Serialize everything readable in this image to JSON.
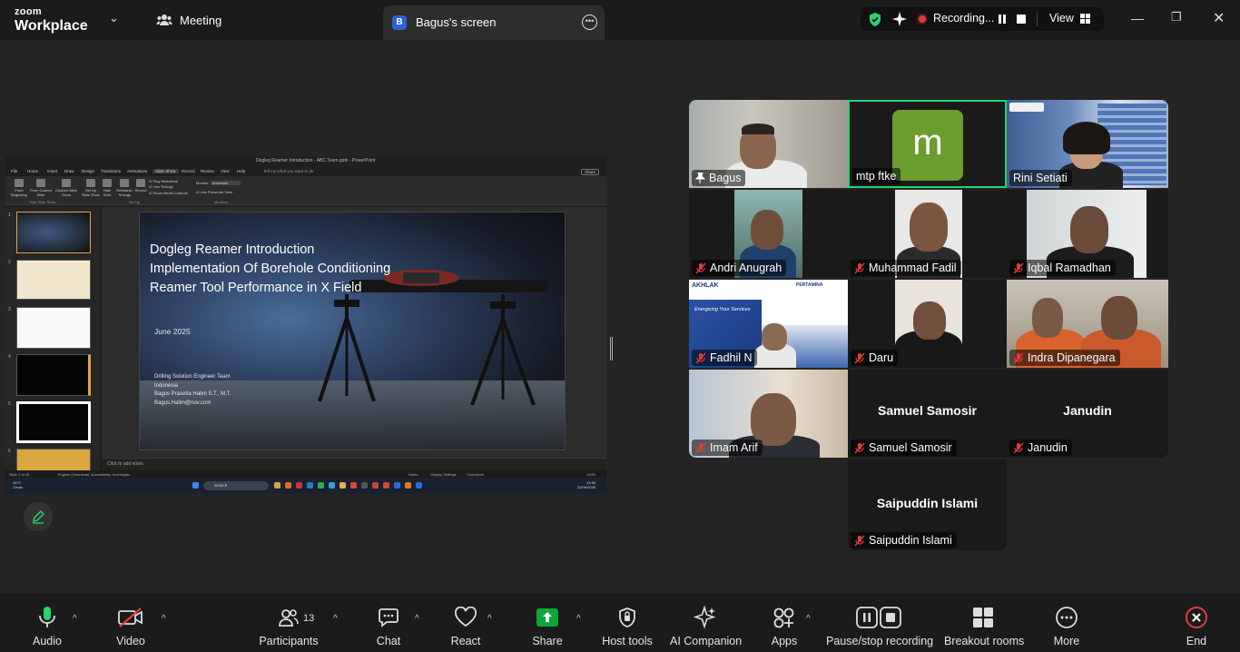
{
  "topbar": {
    "brand_line1": "zoom",
    "brand_line2": "Workplace",
    "meeting_tab": "Meeting",
    "screen_tab_badge": "B",
    "screen_tab_title": "Bagus's screen",
    "recording_text": "Recording...",
    "view_label": "View"
  },
  "share": {
    "window_title": "Dogleg Reamer Introduction - ABC Team.pptx - PowerPoint",
    "ribbon_tabs": [
      "File",
      "Home",
      "Insert",
      "Draw",
      "Design",
      "Transitions",
      "Animations",
      "Slide Show",
      "Record",
      "Review",
      "View",
      "Help"
    ],
    "active_tab": "Slide Show",
    "tell_me": "Tell me what you want to do",
    "share_btn": "Share",
    "ribbon_buttons": [
      "From Beginning",
      "From Current Slide",
      "Custom Slide Show",
      "Set Up Slide Show",
      "Hide Slide",
      "Rehearse Timings",
      "Record"
    ],
    "checkboxes": [
      "Play Narrations",
      "Use Timings",
      "Show Media Controls"
    ],
    "monitor_label": "Monitor:",
    "monitor_value": "Automatic",
    "presenter_view": "Use Presenter View",
    "group_labels": [
      "Start Slide Show",
      "Set Up",
      "Monitors"
    ],
    "slide_numbers": [
      "1",
      "2",
      "3",
      "4",
      "5",
      "6"
    ],
    "slide_title_lines": [
      "Dogleg Reamer Introduction",
      "Implementation Of Borehole Conditioning",
      "Reamer Tool Performance in X Field"
    ],
    "slide_date": "June 2025",
    "slide_team_lines": [
      "Drilling Solution Engineer Team",
      "Indonesia",
      "Bagus Prasetia Halim S.T., M.T.",
      "Bagus.Halim@nov.com"
    ],
    "notes_placeholder": "Click to add notes",
    "status_items": [
      "Slide 1 of 45",
      "English (Indonesia)",
      "Accessibility: Investigate",
      "Notes",
      "Display Settings",
      "Comments",
      "100%"
    ],
    "taskbar_search": "Search",
    "weather": [
      "28°C",
      "Cerah"
    ],
    "clock": [
      "13:53",
      "22/06/2025"
    ]
  },
  "participants": [
    {
      "name": "Bagus",
      "muted": false,
      "pinned": true,
      "video": true
    },
    {
      "name": "mtp ftke",
      "muted": false,
      "video": false,
      "avatar_letter": "m",
      "active": true
    },
    {
      "name": "Rini Setiati",
      "muted": false,
      "video": true
    },
    {
      "name": "Andri Anugrah",
      "muted": true,
      "video": true
    },
    {
      "name": "Muhammad Fadil",
      "muted": true,
      "video": true
    },
    {
      "name": "Iqbal Ramadhan",
      "muted": true,
      "video": true
    },
    {
      "name": "Fadhil N",
      "muted": true,
      "video": true,
      "banner": [
        "AKHLAK",
        "PERTAMINA",
        "Energizing Your Services"
      ]
    },
    {
      "name": "Daru",
      "muted": true,
      "video": true
    },
    {
      "name": "Indra Dipanegara",
      "muted": true,
      "video": true
    },
    {
      "name": "Imam Arif",
      "muted": true,
      "video": true
    },
    {
      "name": "Samuel Samosir",
      "muted": true,
      "video": false
    },
    {
      "name": "Janudin",
      "muted": true,
      "video": false
    },
    {
      "name": "Saipuddin Islami",
      "muted": true,
      "video": false
    }
  ],
  "toolbar": {
    "audio": "Audio",
    "video": "Video",
    "participants": "Participants",
    "participants_count": "13",
    "chat": "Chat",
    "react": "React",
    "share": "Share",
    "host_tools": "Host tools",
    "ai_companion": "AI Companion",
    "apps": "Apps",
    "pause_stop": "Pause/stop recording",
    "breakout": "Breakout rooms",
    "more": "More",
    "end": "End"
  },
  "colors": {
    "share_green": "#0fa53c",
    "active_speaker": "#2bd16e",
    "avatar_green": "#6d9c2f",
    "mute_red": "#e23b3b",
    "end_red": "#e23b3b"
  }
}
